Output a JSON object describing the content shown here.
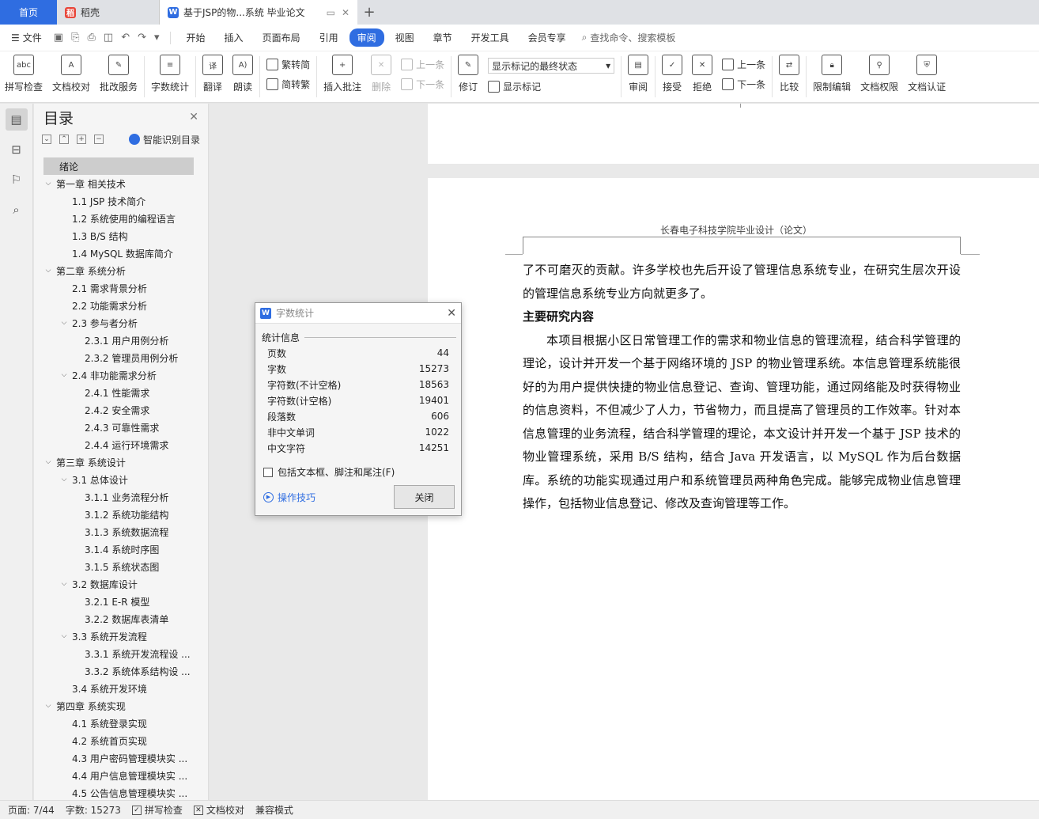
{
  "tabs": {
    "home": "首页",
    "docer": "稻壳",
    "doc": "基于JSP的物...系统 毕业论文"
  },
  "menu": {
    "file": "文件",
    "items": [
      "开始",
      "插入",
      "页面布局",
      "引用",
      "审阅",
      "视图",
      "章节",
      "开发工具",
      "会员专享"
    ],
    "active": "审阅",
    "search": "查找命令、搜索模板"
  },
  "ribbon": {
    "spell": "拼写检查",
    "doccheck": "文档校对",
    "batch": "批改服务",
    "wordcount": "字数统计",
    "translate": "翻译",
    "read": "朗读",
    "t2s": "繁转简",
    "s2t": "简转繁",
    "insert_comment": "插入批注",
    "delete": "删除",
    "prev_comment": "上一条",
    "next_comment": "下一条",
    "track": "修订",
    "markup_select": "显示标记的最终状态",
    "show_markup": "显示标记",
    "review": "审阅",
    "accept": "接受",
    "reject": "拒绝",
    "prev_change": "上一条",
    "next_change": "下一条",
    "compare": "比较",
    "restrict": "限制编辑",
    "perm": "文档权限",
    "cert": "文档认证"
  },
  "toc": {
    "title": "目录",
    "smart": "智能识别目录",
    "items": [
      {
        "text": "绪论",
        "level": 0,
        "chev": false,
        "selected": true
      },
      {
        "text": "第一章  相关技术",
        "level": 0,
        "chev": true
      },
      {
        "text": "1.1 JSP 技术简介",
        "level": 1,
        "chev": false
      },
      {
        "text": "1.2  系统使用的编程语言",
        "level": 1,
        "chev": false
      },
      {
        "text": "1.3 B/S 结构",
        "level": 1,
        "chev": false
      },
      {
        "text": "1.4 MySQL 数据库简介",
        "level": 1,
        "chev": false
      },
      {
        "text": "第二章  系统分析",
        "level": 0,
        "chev": true
      },
      {
        "text": "2.1  需求背景分析",
        "level": 1,
        "chev": false
      },
      {
        "text": "2.2  功能需求分析",
        "level": 1,
        "chev": false
      },
      {
        "text": "2.3  参与者分析",
        "level": 1,
        "chev": true
      },
      {
        "text": "2.3.1  用户用例分析",
        "level": 2,
        "chev": false
      },
      {
        "text": "2.3.2  管理员用例分析",
        "level": 2,
        "chev": false
      },
      {
        "text": "2.4  非功能需求分析",
        "level": 1,
        "chev": true
      },
      {
        "text": "2.4.1  性能需求",
        "level": 2,
        "chev": false
      },
      {
        "text": "2.4.2  安全需求",
        "level": 2,
        "chev": false
      },
      {
        "text": "2.4.3  可靠性需求",
        "level": 2,
        "chev": false
      },
      {
        "text": "2.4.4  运行环境需求",
        "level": 2,
        "chev": false
      },
      {
        "text": "第三章  系统设计",
        "level": 0,
        "chev": true
      },
      {
        "text": "3.1  总体设计",
        "level": 1,
        "chev": true
      },
      {
        "text": "3.1.1  业务流程分析",
        "level": 2,
        "chev": false
      },
      {
        "text": "3.1.2  系统功能结构",
        "level": 2,
        "chev": false
      },
      {
        "text": "3.1.3  系统数据流程",
        "level": 2,
        "chev": false
      },
      {
        "text": "3.1.4  系统时序图",
        "level": 2,
        "chev": false
      },
      {
        "text": "3.1.5  系统状态图",
        "level": 2,
        "chev": false
      },
      {
        "text": "3.2  数据库设计",
        "level": 1,
        "chev": true
      },
      {
        "text": "3.2.1 E-R 模型",
        "level": 2,
        "chev": false
      },
      {
        "text": "3.2.2  数据库表清单",
        "level": 2,
        "chev": false
      },
      {
        "text": "3.3  系统开发流程",
        "level": 1,
        "chev": true
      },
      {
        "text": "3.3.1  系统开发流程设 ...",
        "level": 2,
        "chev": false
      },
      {
        "text": "3.3.2  系统体系结构设 ...",
        "level": 2,
        "chev": false
      },
      {
        "text": "3.4  系统开发环境",
        "level": 1,
        "chev": false
      },
      {
        "text": "第四章  系统实现",
        "level": 0,
        "chev": true
      },
      {
        "text": "4.1  系统登录实现",
        "level": 1,
        "chev": false
      },
      {
        "text": "4.2  系统首页实现",
        "level": 1,
        "chev": false
      },
      {
        "text": "4.3  用户密码管理模块实 ...",
        "level": 1,
        "chev": false
      },
      {
        "text": "4.4  用户信息管理模块实 ...",
        "level": 1,
        "chev": false
      },
      {
        "text": "4.5  公告信息管理模块实 ...",
        "level": 1,
        "chev": false
      }
    ]
  },
  "document": {
    "header": "长春电子科技学院毕业设计（论文）",
    "p1": "了不可磨灭的贡献。许多学校也先后开设了管理信息系统专业，在研究生层次开设的管理信息系统专业方向就更多了。",
    "heading": "主要研究内容",
    "p2": "本项目根据小区日常管理工作的需求和物业信息的管理流程，结合科学管理的理论，设计并开发一个基于网络环境的 JSP 的物业管理系统。本信息管理系统能很好的为用户提供快捷的物业信息登记、查询、管理功能，通过网络能及时获得物业的信息资料，不但减少了人力，节省物力，而且提高了管理员的工作效率。针对本信息管理的业务流程，结合科学管理的理论，本文设计并开发一个基于 JSP 技术的物业管理系统，采用 B/S 结构，结合 Java 开发语言，以 MySQL 作为后台数据库。系统的功能实现通过用户和系统管理员两种角色完成。能够完成物业信息管理操作，包括物业信息登记、修改及查询管理等工作。"
  },
  "dialog": {
    "title": "字数统计",
    "section": "统计信息",
    "rows": [
      {
        "label": "页数",
        "value": "44"
      },
      {
        "label": "字数",
        "value": "15273"
      },
      {
        "label": "字符数(不计空格)",
        "value": "18563"
      },
      {
        "label": "字符数(计空格)",
        "value": "19401"
      },
      {
        "label": "段落数",
        "value": "606"
      },
      {
        "label": "非中文单词",
        "value": "1022"
      },
      {
        "label": "中文字符",
        "value": "14251"
      }
    ],
    "checkbox": "包括文本框、脚注和尾注(F)",
    "tips": "操作技巧",
    "close": "关闭"
  },
  "status": {
    "page": "页面: 7/44",
    "words": "字数: 15273",
    "spell": "拼写检查",
    "check": "文档校对",
    "compat": "兼容模式"
  },
  "colors": {
    "accent": "#2f6de1",
    "docer": "#e8473b"
  }
}
